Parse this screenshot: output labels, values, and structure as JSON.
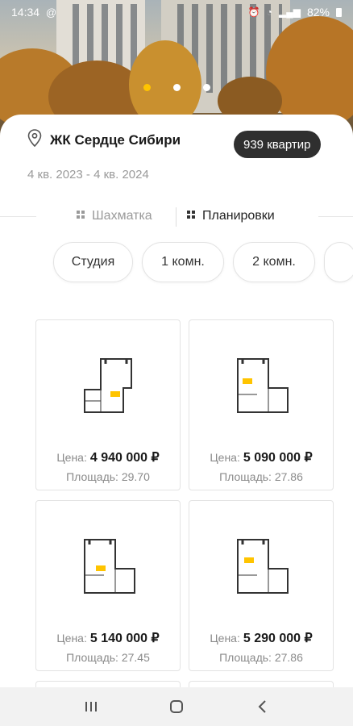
{
  "status_bar": {
    "time": "14:34",
    "battery": "82%"
  },
  "carousel": {
    "slides": 3,
    "active": 0
  },
  "complex": {
    "name": "ЖК Сердце Сибири",
    "apartments_badge": "939 квартир",
    "dates": "4 кв. 2023 - 4 кв. 2024"
  },
  "tabs": [
    {
      "label": "Шахматка",
      "active": false
    },
    {
      "label": "Планировки",
      "active": true
    }
  ],
  "filters": [
    "Студия",
    "1 комн.",
    "2 комн."
  ],
  "cards": [
    {
      "price_label": "Цена:",
      "price": "4 940 000 ₽",
      "area": "Площадь: 29.70"
    },
    {
      "price_label": "Цена:",
      "price": "5 090 000 ₽",
      "area": "Площадь: 27.86"
    },
    {
      "price_label": "Цена:",
      "price": "5 140 000 ₽",
      "area": "Площадь: 27.45"
    },
    {
      "price_label": "Цена:",
      "price": "5 290 000 ₽",
      "area": "Площадь: 27.86"
    }
  ],
  "icons": {
    "location": "map-pin-icon",
    "grid": "grid-icon",
    "back": "back-icon",
    "home": "home-icon",
    "recents": "recents-icon"
  },
  "colors": {
    "accent": "#ffc400",
    "badge_bg": "#2f2f2f"
  }
}
